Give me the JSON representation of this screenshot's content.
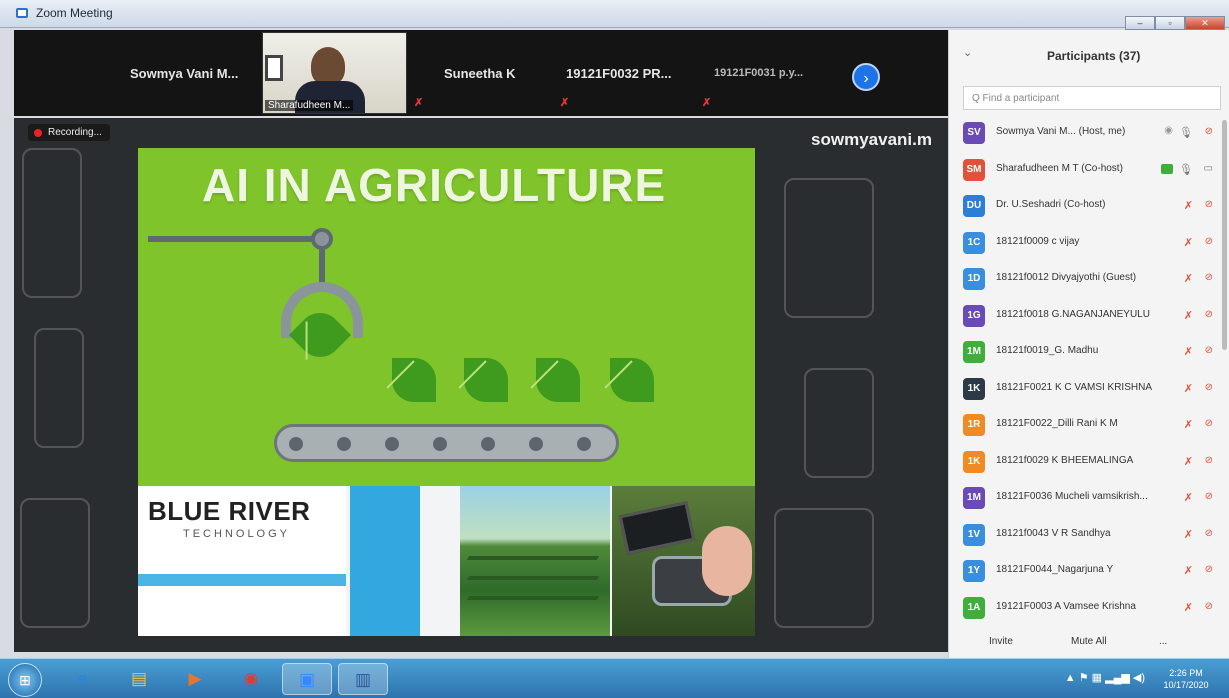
{
  "window": {
    "title": "Zoom Meeting",
    "min_label": "–",
    "max_label": "▫",
    "close_label": "✕"
  },
  "gallery": {
    "tiles": [
      {
        "name": "Sowmya Vani M..."
      },
      {
        "name": "Sharafudheen M..."
      },
      {
        "name": "Suneetha K"
      },
      {
        "name": "19121F0032 PR..."
      },
      {
        "name": "19121F0031 p.y..."
      }
    ],
    "next_icon": "›"
  },
  "share": {
    "recording_label": "Recording...",
    "sharer_name": "sowmyavani.m",
    "slide": {
      "title": "AI IN AGRICULTURE",
      "logo_name": "BLUE RIVER",
      "logo_sub": "TECHNOLOGY"
    }
  },
  "panel": {
    "title": "Participants (37)",
    "collapse_icon": "⌄",
    "search_placeholder": "Q Find a participant",
    "participants": [
      {
        "initials": "SV",
        "color": "#6a4bb5",
        "name": "Sowmya Vani M... (Host, me)",
        "mic": "on",
        "cam": "off"
      },
      {
        "initials": "SM",
        "color": "#e0523a",
        "name": "Sharafudheen M T (Co-host)",
        "mic": "on",
        "cam": "on"
      },
      {
        "initials": "DU",
        "color": "#2d7fd6",
        "name": "Dr. U.Seshadri (Co-host)",
        "mic": "off",
        "cam": "off"
      },
      {
        "initials": "1C",
        "color": "#3a8ee0",
        "name": "18121f0009 c vijay",
        "mic": "off",
        "cam": "off"
      },
      {
        "initials": "1D",
        "color": "#3a8ee0",
        "name": "18121f0012 Divyajyothi (Guest)",
        "mic": "off",
        "cam": "off"
      },
      {
        "initials": "1G",
        "color": "#6a4bb5",
        "name": "18121f0018 G.NAGANJANEYULU",
        "mic": "off",
        "cam": "off"
      },
      {
        "initials": "1M",
        "color": "#3fae3a",
        "name": "18121f0019_G. Madhu",
        "mic": "off",
        "cam": "off"
      },
      {
        "initials": "1K",
        "color": "#2b3a46",
        "name": "18121F0021 K C VAMSI KRISHNA",
        "mic": "off",
        "cam": "off"
      },
      {
        "initials": "1R",
        "color": "#f08a24",
        "name": "18121F0022_Dilli Rani K M",
        "mic": "off",
        "cam": "off"
      },
      {
        "initials": "1K",
        "color": "#f08a24",
        "name": "18121f0029 K BHEEMALINGA",
        "mic": "off",
        "cam": "off"
      },
      {
        "initials": "1M",
        "color": "#6a4bb5",
        "name": "18121F0036 Mucheli vamsikrish...",
        "mic": "off",
        "cam": "off"
      },
      {
        "initials": "1V",
        "color": "#3a8ee0",
        "name": "18121f0043 V R Sandhya",
        "mic": "off",
        "cam": "off"
      },
      {
        "initials": "1Y",
        "color": "#3a8ee0",
        "name": "18121F0044_Nagarjuna Y",
        "mic": "off",
        "cam": "off"
      },
      {
        "initials": "1A",
        "color": "#3fae3a",
        "name": "19121F0003 A Vamsee Krishna",
        "mic": "off",
        "cam": "off"
      }
    ],
    "invite_label": "Invite",
    "mute_all_label": "Mute All",
    "more_label": "..."
  },
  "taskbar": {
    "start_icon": "windows-start-icon",
    "apps": [
      {
        "icon": "internet-explorer-icon",
        "glyph": "e"
      },
      {
        "icon": "file-explorer-icon",
        "glyph": "▤"
      },
      {
        "icon": "media-player-icon",
        "glyph": "▶"
      },
      {
        "icon": "chrome-icon",
        "glyph": "◉"
      },
      {
        "icon": "zoom-icon",
        "glyph": "▣"
      },
      {
        "icon": "word-document-icon",
        "glyph": "▥"
      }
    ],
    "tray_icons": "▲ ⚑ ▦ ▂▄▆ ◀)",
    "time": "2:26 PM",
    "date": "10/17/2020"
  }
}
